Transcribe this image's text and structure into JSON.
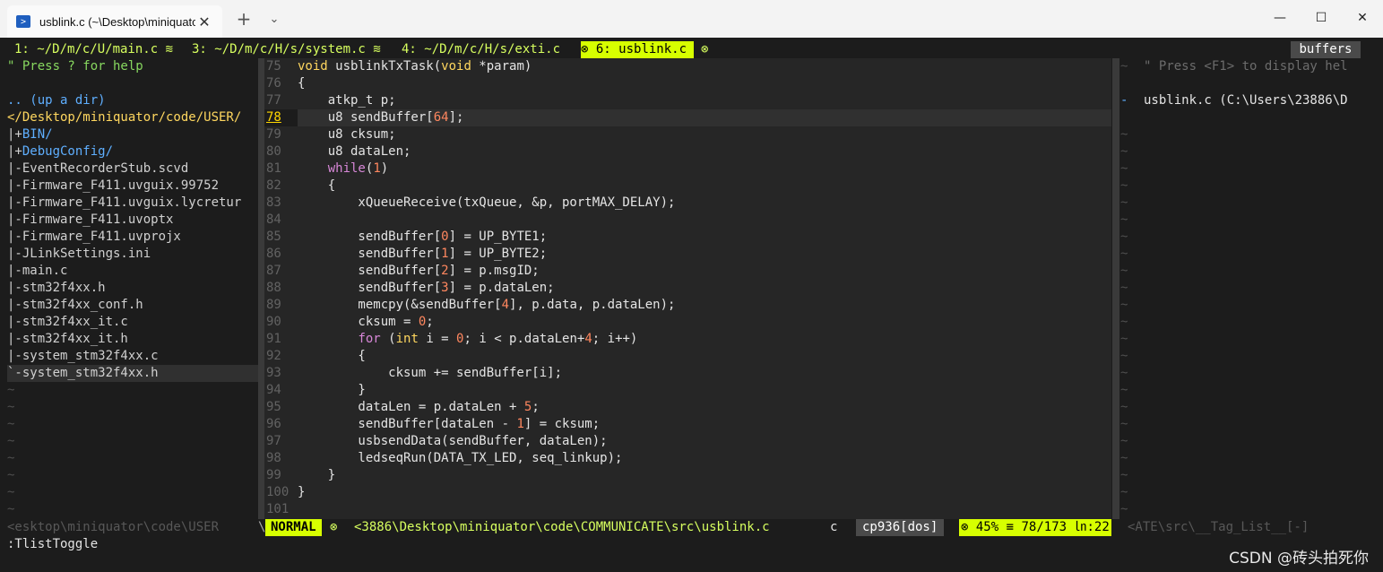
{
  "window": {
    "tab_title": "usblink.c (~\\Desktop\\miniquato",
    "new_tab_label": "+",
    "dropdown_label": "⌄",
    "min_label": "—",
    "max_label": "☐",
    "close_label": "✕"
  },
  "tabline": {
    "tabs": [
      {
        "label": "1: ~/D/m/c/U/main.c",
        "sep": "≋"
      },
      {
        "label": "3: ~/D/m/c/H/s/system.c",
        "sep": "≋"
      },
      {
        "label": "4: ~/D/m/c/H/s/exti.c",
        "sep": ""
      },
      {
        "label": "6: usblink.c",
        "sep": ""
      }
    ],
    "active_marker": "⊗",
    "buffers_label": "buffers"
  },
  "left_pane": {
    "help": "\" Press ? for help",
    "updir": ".. (up a dir)",
    "cwd": "</Desktop/miniquator/code/USER/",
    "dirs": [
      "BIN/",
      "DebugConfig/"
    ],
    "files": [
      "EventRecorderStub.scvd",
      "Firmware_F411.uvguix.99752",
      "Firmware_F411.uvguix.lycretur",
      "Firmware_F411.uvoptx",
      "Firmware_F411.uvprojx",
      "JLinkSettings.ini",
      "main.c",
      "stm32f4xx.h",
      "stm32f4xx_conf.h",
      "stm32f4xx_it.c",
      "stm32f4xx_it.h",
      "system_stm32f4xx.c",
      "system_stm32f4xx.h"
    ]
  },
  "code": {
    "lines": [
      {
        "n": "75",
        "t": "void usblinkTxTask(void *param)"
      },
      {
        "n": "76",
        "t": "{"
      },
      {
        "n": "77",
        "t": "    atkp_t p;"
      },
      {
        "n": "78",
        "t": "    u8 sendBuffer[64];"
      },
      {
        "n": "79",
        "t": "    u8 cksum;"
      },
      {
        "n": "80",
        "t": "    u8 dataLen;"
      },
      {
        "n": "81",
        "t": "    while(1)"
      },
      {
        "n": "82",
        "t": "    {"
      },
      {
        "n": "83",
        "t": "        xQueueReceive(txQueue, &p, portMAX_DELAY);"
      },
      {
        "n": "84",
        "t": ""
      },
      {
        "n": "85",
        "t": "        sendBuffer[0] = UP_BYTE1;"
      },
      {
        "n": "86",
        "t": "        sendBuffer[1] = UP_BYTE2;"
      },
      {
        "n": "87",
        "t": "        sendBuffer[2] = p.msgID;"
      },
      {
        "n": "88",
        "t": "        sendBuffer[3] = p.dataLen;"
      },
      {
        "n": "89",
        "t": "        memcpy(&sendBuffer[4], p.data, p.dataLen);"
      },
      {
        "n": "90",
        "t": "        cksum = 0;"
      },
      {
        "n": "91",
        "t": "        for (int i = 0; i < p.dataLen+4; i++)"
      },
      {
        "n": "92",
        "t": "        {"
      },
      {
        "n": "93",
        "t": "            cksum += sendBuffer[i];"
      },
      {
        "n": "94",
        "t": "        }"
      },
      {
        "n": "95",
        "t": "        dataLen = p.dataLen + 5;"
      },
      {
        "n": "96",
        "t": "        sendBuffer[dataLen - 1] = cksum;"
      },
      {
        "n": "97",
        "t": "        usbsendData(sendBuffer, dataLen);"
      },
      {
        "n": "98",
        "t": "        ledseqRun(DATA_TX_LED, seq_linkup);"
      },
      {
        "n": "99",
        "t": "    }"
      },
      {
        "n": "100",
        "t": "}"
      },
      {
        "n": "101",
        "t": ""
      }
    ],
    "current_line": "78"
  },
  "right_pane": {
    "help": "\" Press <F1> to display hel",
    "marker": "-",
    "entry": "usblink.c (C:\\Users\\23886\\D"
  },
  "status": {
    "left": "<esktop\\miniquator\\code\\USER",
    "mode": "NORMAL",
    "mode_sep": "⊗",
    "file": "<3886\\Desktop\\miniquator\\code\\COMMUNICATE\\src\\usblink.c",
    "filetype": "c",
    "encoding": "cp936[dos]",
    "enc_sep": "⊗",
    "percent": "45%",
    "line_sym": "≡",
    "position": "78/173",
    "col_sym": "㏑:22",
    "right": "<ATE\\src\\__Tag_List__[-]"
  },
  "cmdline": ":TlistToggle",
  "watermark": "CSDN @砖头拍死你",
  "colors": {
    "accent": "#d7ff00",
    "background": "#1c1c1c",
    "code_bg": "#262626"
  }
}
